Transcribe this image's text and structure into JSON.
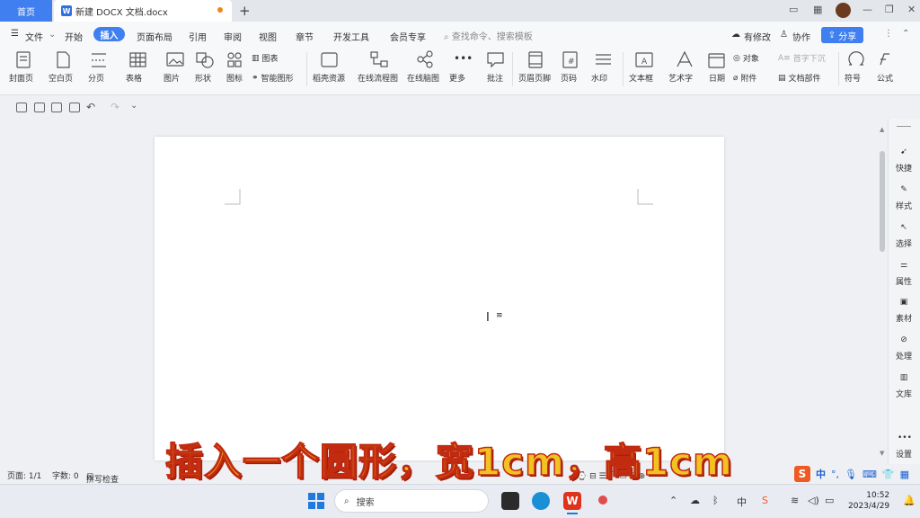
{
  "tabs": {
    "home": "首页",
    "doc": "新建 DOCX 文档.docx",
    "new": "+"
  },
  "menu": {
    "file": "文件",
    "start": "开始",
    "insert": "插入",
    "layout": "页面布局",
    "references": "引用",
    "review": "审阅",
    "view": "视图",
    "chapter": "章节",
    "developer": "开发工具",
    "member": "会员专享",
    "search_placeholder": "查找命令、搜索模板",
    "has_changes": "有修改",
    "collab": "协作",
    "share": "分享"
  },
  "ribbon": {
    "cover": "封面页",
    "blank": "空白页",
    "pagebreak": "分页",
    "table": "表格",
    "picture": "图片",
    "shape": "形状",
    "iconlib": "图标",
    "chart": "图表",
    "smartart": "智能图形",
    "daoke": "稻壳资源",
    "flowchart": "在线流程图",
    "mindmap": "在线脑图",
    "more": "更多",
    "comment": "批注",
    "headerfooter": "页眉页脚",
    "pagenum": "页码",
    "watermark": "水印",
    "textbox": "文本框",
    "wordart": "艺术字",
    "date": "日期",
    "object": "对象",
    "dropcap": "首字下沉",
    "attachment": "附件",
    "docparts": "文档部件",
    "symbol": "符号",
    "formula": "公式"
  },
  "right_panel": [
    "快捷",
    "样式",
    "选择",
    "属性",
    "素材",
    "处理",
    "文库",
    "设置"
  ],
  "status": {
    "page": "页面: 1/1",
    "words": "字数: 0",
    "spell": "拼写检查"
  },
  "subtitle": "插入一个圆形，宽1cm，高1cm",
  "ime": {
    "lang": "中"
  },
  "taskbar": {
    "search": "搜索",
    "time": "10:52",
    "date": "2023/4/29"
  },
  "colors": {
    "accent": "#3f7ff0",
    "subtitle_fill": "#f2c122",
    "subtitle_stroke": "#c22b10"
  }
}
